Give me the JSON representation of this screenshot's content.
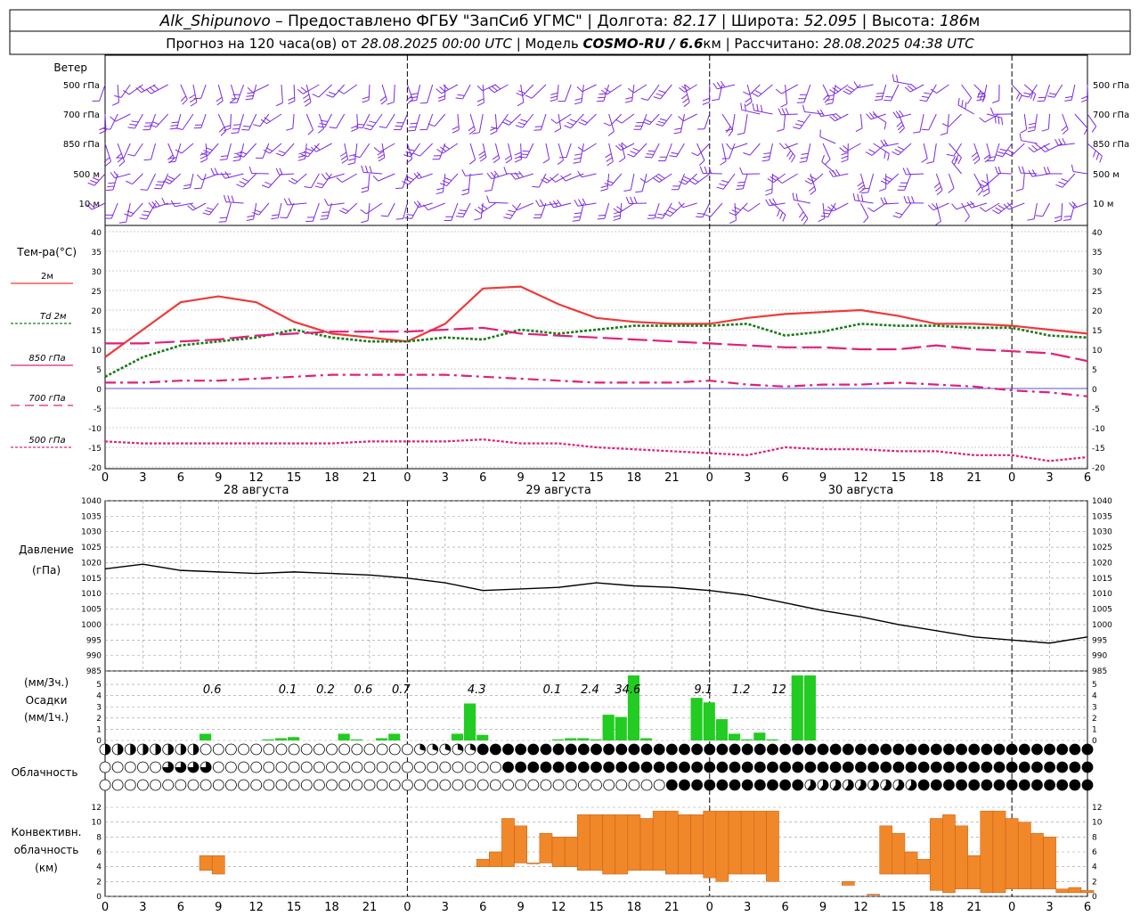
{
  "header": {
    "station": "Alk_Shipunovo",
    "provider": " – Предоставлено ФГБУ \"ЗапСиб УГМС\" | Долгота: ",
    "lon": "82.17",
    "lat_label": " | Широта: ",
    "lat": "52.095",
    "alt_label": " | Высота: ",
    "alt": "186",
    "alt_unit": "м",
    "line2_a": "Прогноз на 120 часа(ов) от ",
    "issue": "28.08.2025 00:00 UTC",
    "line2_b": "  | Модель ",
    "model": "COSMO-RU / 6.6",
    "model_unit": "км",
    "line2_c": " | Рассчитано: ",
    "calc": "28.08.2025 04:38 UTC"
  },
  "wind": {
    "title": "Ветер",
    "levels": [
      "500 гПа",
      "700 гПа",
      "850 гПа",
      "500 м",
      "10  м"
    ],
    "right_levels": [
      "500 гПа",
      "700 гПа",
      "850 гПа",
      "500 м",
      "10 м"
    ],
    "color": "#7a2be2"
  },
  "temp": {
    "title": "Тем-ра(°C)",
    "legend": [
      {
        "label": "2м",
        "color": "#ee3a3a",
        "dash": ""
      },
      {
        "label": "Td  2м",
        "color": "#1a7a1a",
        "dash": "3,2"
      },
      {
        "label": "850 гПа",
        "color": "#e0207a",
        "dash": ""
      },
      {
        "label": "700 гПа",
        "color": "#e0207a",
        "dash": "10,6"
      },
      {
        "label": "500 гПа",
        "color": "#e0207a",
        "dash": "3,2"
      }
    ],
    "yticks": [
      "40",
      "35",
      "30",
      "25",
      "20",
      "15",
      "10",
      "5",
      "0",
      "-5",
      "-10",
      "-15",
      "-20"
    ]
  },
  "time_axis": {
    "hours": [
      "0",
      "3",
      "6",
      "9",
      "12",
      "15",
      "18",
      "21",
      "0",
      "3",
      "6",
      "9",
      "12",
      "15",
      "18",
      "21",
      "0",
      "3",
      "6",
      "9",
      "12",
      "15",
      "18",
      "21",
      "0",
      "3",
      "6"
    ],
    "days": [
      "28 августа",
      "29 августа",
      "30 августа"
    ]
  },
  "pressure": {
    "title": "Давление",
    "unit": "(гПа)",
    "yticks": [
      "1040",
      "1035",
      "1030",
      "1025",
      "1020",
      "1015",
      "1010",
      "1005",
      "1000",
      "995",
      "990",
      "985"
    ]
  },
  "precip": {
    "unit3": "(мм/3ч.)",
    "title": "Осадки",
    "unit1": "(мм/1ч.)",
    "yticks": [
      "5",
      "4",
      "3",
      "2",
      "1",
      "0"
    ],
    "amounts": [
      {
        "h": 8.5,
        "text": "0.6"
      },
      {
        "h": 14.5,
        "text": "0.1"
      },
      {
        "h": 17.5,
        "text": "0.2"
      },
      {
        "h": 20.5,
        "text": "0.6"
      },
      {
        "h": 23.5,
        "text": "0.7"
      },
      {
        "h": 29.5,
        "text": "4.3"
      },
      {
        "h": 35.5,
        "text": "0.1"
      },
      {
        "h": 38.5,
        "text": "2.4"
      },
      {
        "h": 41.5,
        "text": "34.6"
      },
      {
        "h": 47.5,
        "text": "9.1"
      },
      {
        "h": 50.5,
        "text": "1.2"
      },
      {
        "h": 53.5,
        "text": "12"
      }
    ],
    "color": "#22cc22"
  },
  "cloud": {
    "title": "Облачность"
  },
  "conv": {
    "title1": "Конвективн.",
    "title2": "облачность",
    "title3": "(км)",
    "yticks": [
      "12",
      "10",
      "8",
      "6",
      "4",
      "2",
      "0"
    ],
    "color": "#f0882a"
  },
  "chart_data": [
    {
      "type": "line",
      "title": "Тем-ра(°C)",
      "x_unit": "hours from 28.08.2025 00:00 UTC",
      "ylim": [
        -20,
        40
      ],
      "series": [
        {
          "name": "2м",
          "x": [
            0,
            3,
            6,
            9,
            12,
            15,
            18,
            21,
            24,
            27,
            30,
            33,
            36,
            39,
            42,
            45,
            48,
            51,
            54,
            57,
            60,
            63,
            66,
            69,
            72,
            75,
            78
          ],
          "values": [
            8,
            15,
            22,
            23.5,
            22,
            17,
            14,
            13,
            12,
            16.5,
            25.5,
            26,
            21.5,
            18,
            17,
            16.5,
            16.5,
            18,
            19,
            19.5,
            20,
            18.5,
            16.5,
            16.5,
            16,
            15,
            14
          ]
        },
        {
          "name": "Td  2м",
          "x": [
            0,
            3,
            6,
            9,
            12,
            15,
            18,
            21,
            24,
            27,
            30,
            33,
            36,
            39,
            42,
            45,
            48,
            51,
            54,
            57,
            60,
            63,
            66,
            69,
            72,
            75,
            78
          ],
          "values": [
            3,
            8,
            11,
            12,
            13,
            15,
            13,
            12,
            12,
            13,
            12.5,
            15,
            14,
            15,
            16,
            16,
            16,
            16.5,
            13.5,
            14.5,
            16.5,
            16,
            16,
            15.5,
            15.5,
            13.5,
            13
          ]
        },
        {
          "name": "850 гПа",
          "x": [
            0,
            3,
            6,
            9,
            12,
            15,
            18,
            21,
            24,
            27,
            30,
            33,
            36,
            39,
            42,
            45,
            48,
            51,
            54,
            57,
            60,
            63,
            66,
            69,
            72,
            75,
            78
          ],
          "values": [
            11.5,
            11.5,
            12,
            12.5,
            13.5,
            14,
            14.5,
            14.5,
            14.5,
            15,
            15.5,
            14,
            13.5,
            13,
            12.5,
            12,
            11.5,
            11,
            10.5,
            10.5,
            10,
            10,
            11,
            10,
            9.5,
            9,
            7
          ]
        },
        {
          "name": "700 гПа",
          "x": [
            0,
            3,
            6,
            9,
            12,
            15,
            18,
            21,
            24,
            27,
            30,
            33,
            36,
            39,
            42,
            45,
            48,
            51,
            54,
            57,
            60,
            63,
            66,
            69,
            72,
            75,
            78
          ],
          "values": [
            1.5,
            1.5,
            2,
            2,
            2.5,
            3,
            3.5,
            3.5,
            3.5,
            3.5,
            3,
            2.5,
            2,
            1.5,
            1.5,
            1.5,
            2,
            1,
            0.5,
            1,
            1,
            1.5,
            1,
            0.5,
            -0.5,
            -1,
            -2
          ]
        },
        {
          "name": "500 гПа",
          "x": [
            0,
            3,
            6,
            9,
            12,
            15,
            18,
            21,
            24,
            27,
            30,
            33,
            36,
            39,
            42,
            45,
            48,
            51,
            54,
            57,
            60,
            63,
            66,
            69,
            72,
            75,
            78
          ],
          "values": [
            -13.5,
            -14,
            -14,
            -14,
            -14,
            -14,
            -14,
            -13.5,
            -13.5,
            -13.5,
            -13,
            -14,
            -14,
            -15,
            -15.5,
            -16,
            -16.5,
            -17,
            -15,
            -15.5,
            -15.5,
            -16,
            -16,
            -17,
            -17,
            -18.5,
            -17.5
          ]
        }
      ]
    },
    {
      "type": "line",
      "title": "Давление",
      "ylabel": "(гПа)",
      "x_unit": "hours from 28.08.2025 00:00 UTC",
      "ylim": [
        985,
        1040
      ],
      "series": [
        {
          "name": "",
          "x": [
            0,
            3,
            6,
            9,
            12,
            15,
            18,
            21,
            24,
            27,
            30,
            33,
            36,
            39,
            42,
            45,
            48,
            51,
            54,
            57,
            60,
            63,
            66,
            69,
            72,
            75,
            78
          ],
          "values": [
            1018,
            1019.5,
            1017.5,
            1017,
            1016.5,
            1017,
            1016.5,
            1016,
            1015,
            1013.5,
            1011,
            1011.5,
            1012,
            1013.5,
            1012.5,
            1012,
            1011,
            1009.5,
            1007,
            1004.5,
            1002.5,
            1000,
            998,
            996,
            995,
            994,
            996
          ]
        }
      ]
    },
    {
      "type": "bar",
      "title": "Осадки",
      "ylabel": "(мм/1ч.)",
      "x_unit": "hours from 28.08.2025 00:00 UTC",
      "ylim": [
        0,
        6
      ],
      "x": [
        8,
        13,
        14,
        15,
        19,
        20,
        22,
        23,
        28,
        29,
        30,
        36,
        37,
        38,
        39,
        40,
        41,
        42,
        43,
        47,
        48,
        49,
        50,
        51,
        52,
        53,
        55,
        56
      ],
      "values": [
        0.6,
        0.1,
        0.2,
        0.3,
        0.6,
        0.1,
        0.2,
        0.6,
        0.6,
        3.3,
        0.5,
        0.1,
        0.2,
        0.2,
        0.1,
        2.3,
        2.1,
        5.8,
        0.2,
        3.8,
        3.4,
        1.9,
        0.6,
        0.1,
        0.7,
        0.1,
        5.8,
        5.8
      ]
    },
    {
      "type": "bar",
      "title": "Конвективн. облачность",
      "ylabel": "(км)",
      "x_unit": "hours from 28.08.2025 00:00 UTC",
      "ylim": [
        0,
        12
      ],
      "bars": [
        {
          "x": 8,
          "top": 5.5,
          "base": 3.5
        },
        {
          "x": 9,
          "top": 5.5,
          "base": 3
        },
        {
          "x": 30,
          "top": 5,
          "base": 4
        },
        {
          "x": 31,
          "top": 6,
          "base": 4
        },
        {
          "x": 32,
          "top": 10.5,
          "base": 4
        },
        {
          "x": 33,
          "top": 9.5,
          "base": 4.5
        },
        {
          "x": 34,
          "top": 4.5,
          "base": 4.5
        },
        {
          "x": 35,
          "top": 8.5,
          "base": 4.5
        },
        {
          "x": 36,
          "top": 8,
          "base": 4
        },
        {
          "x": 37,
          "top": 8,
          "base": 4
        },
        {
          "x": 38,
          "top": 11,
          "base": 3.5
        },
        {
          "x": 39,
          "top": 11,
          "base": 3.5
        },
        {
          "x": 40,
          "top": 11,
          "base": 3
        },
        {
          "x": 41,
          "top": 11,
          "base": 3
        },
        {
          "x": 42,
          "top": 11,
          "base": 3.5
        },
        {
          "x": 43,
          "top": 10.5,
          "base": 3.5
        },
        {
          "x": 44,
          "top": 11.5,
          "base": 3.5
        },
        {
          "x": 45,
          "top": 11.5,
          "base": 3
        },
        {
          "x": 46,
          "top": 11,
          "base": 3
        },
        {
          "x": 47,
          "top": 11,
          "base": 3
        },
        {
          "x": 48,
          "top": 11.5,
          "base": 2.5
        },
        {
          "x": 49,
          "top": 11.5,
          "base": 2
        },
        {
          "x": 50,
          "top": 11.5,
          "base": 3
        },
        {
          "x": 51,
          "top": 11.5,
          "base": 3
        },
        {
          "x": 52,
          "top": 11.5,
          "base": 3
        },
        {
          "x": 53,
          "top": 11.5,
          "base": 2
        },
        {
          "x": 59,
          "top": 2,
          "base": 1.5
        },
        {
          "x": 61,
          "top": 0.3,
          "base": 0.2
        },
        {
          "x": 62,
          "top": 9.5,
          "base": 3
        },
        {
          "x": 63,
          "top": 8.5,
          "base": 3
        },
        {
          "x": 64,
          "top": 6,
          "base": 3
        },
        {
          "x": 65,
          "top": 5,
          "base": 3
        },
        {
          "x": 66,
          "top": 10.5,
          "base": 0.8
        },
        {
          "x": 67,
          "top": 11,
          "base": 0.5
        },
        {
          "x": 68,
          "top": 9.5,
          "base": 1
        },
        {
          "x": 69,
          "top": 5.5,
          "base": 1
        },
        {
          "x": 70,
          "top": 11.5,
          "base": 0.5
        },
        {
          "x": 71,
          "top": 11.5,
          "base": 0.5
        },
        {
          "x": 72,
          "top": 10.5,
          "base": 1
        },
        {
          "x": 73,
          "top": 10,
          "base": 1
        },
        {
          "x": 74,
          "top": 8.5,
          "base": 1
        },
        {
          "x": 75,
          "top": 8,
          "base": 1
        },
        {
          "x": 76,
          "top": 1,
          "base": 0.5
        },
        {
          "x": 77,
          "top": 1.2,
          "base": 0.5
        },
        {
          "x": 78,
          "top": 0.8,
          "base": 0.5
        }
      ]
    }
  ]
}
